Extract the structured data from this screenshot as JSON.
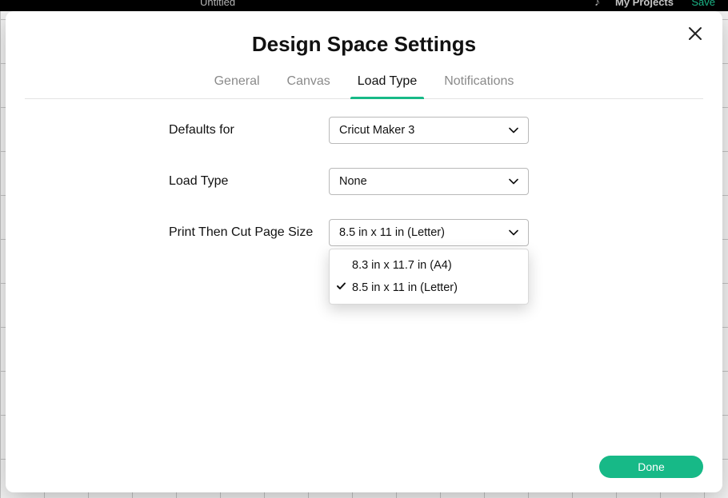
{
  "topbar": {
    "title": "Untitled",
    "my_projects": "My Projects",
    "save": "Save"
  },
  "modal": {
    "title": "Design Space Settings",
    "tabs": {
      "general": "General",
      "canvas": "Canvas",
      "load_type": "Load Type",
      "notifications": "Notifications"
    },
    "fields": {
      "defaults_for": {
        "label": "Defaults for",
        "value": "Cricut Maker 3"
      },
      "load_type": {
        "label": "Load Type",
        "value": "None"
      },
      "page_size": {
        "label": "Print Then Cut Page Size",
        "value": "8.5 in x 11 in (Letter)",
        "options": {
          "a4": "8.3 in x 11.7 in (A4)",
          "letter": "8.5 in x 11 in (Letter)"
        }
      }
    },
    "done": "Done"
  }
}
